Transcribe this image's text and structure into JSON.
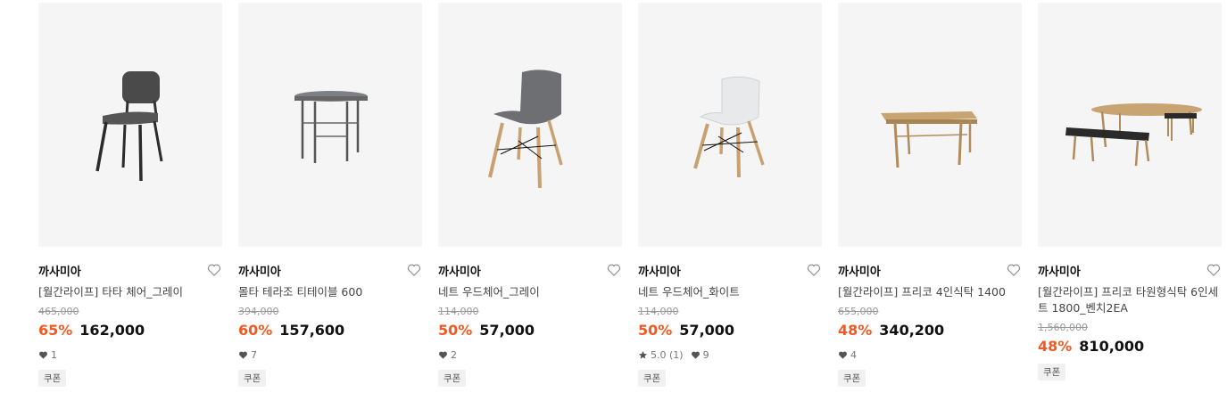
{
  "products": [
    {
      "brand": "까사미아",
      "name": "[월간라이프] 타타 체어_그레이",
      "original_price": "465,000",
      "discount_rate": "65%",
      "price": "162,000",
      "likes": "1",
      "coupon": "쿠폰"
    },
    {
      "brand": "까사미아",
      "name": "몰타 테라조 티테이블 600",
      "original_price": "394,000",
      "discount_rate": "60%",
      "price": "157,600",
      "likes": "7",
      "coupon": "쿠폰"
    },
    {
      "brand": "까사미아",
      "name": "네트 우드체어_그레이",
      "original_price": "114,000",
      "discount_rate": "50%",
      "price": "57,000",
      "likes": "2",
      "coupon": "쿠폰"
    },
    {
      "brand": "까사미아",
      "name": "네트 우드체어_화이트",
      "original_price": "114,000",
      "discount_rate": "50%",
      "price": "57,000",
      "rating": "5.0 (1)",
      "likes": "9",
      "coupon": "쿠폰"
    },
    {
      "brand": "까사미아",
      "name": "[월간라이프] 프리코 4인식탁 1400",
      "original_price": "655,000",
      "discount_rate": "48%",
      "price": "340,200",
      "likes": "4",
      "coupon": "쿠폰"
    },
    {
      "brand": "까사미아",
      "name": "[월간라이프] 프리코 타원형식탁 6인세트 1800_벤치2EA",
      "original_price": "1,560,000",
      "discount_rate": "48%",
      "price": "810,000",
      "coupon": "쿠폰"
    }
  ],
  "icons": {
    "wishlist": "heart-outline-icon",
    "likes": "heart-filled-icon",
    "rating": "star-icon"
  },
  "colors": {
    "discount": "#f15a24",
    "thumb_bg": "#f5f5f5"
  }
}
